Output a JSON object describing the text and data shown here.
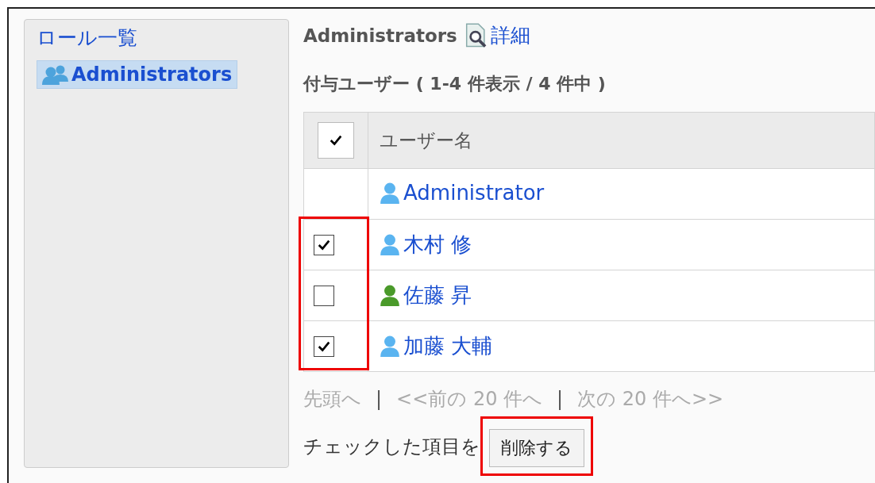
{
  "sidebar": {
    "title": "ロール一覧",
    "items": [
      {
        "label": "Administrators",
        "selected": true
      }
    ]
  },
  "role_title": "Administrators",
  "detail_link": "詳細",
  "section_title": "付与ユーザー ( 1-4 件表示 / 4 件中 )",
  "table": {
    "header_checkbox": {
      "checked": true
    },
    "columns": [
      "ユーザー名"
    ],
    "rows": [
      {
        "name": "Administrator",
        "has_checkbox": false,
        "color": "#5ab4f0",
        "highlighted": false
      },
      {
        "name": "木村 修",
        "has_checkbox": true,
        "checked": true,
        "color": "#5ab4f0",
        "highlighted": true
      },
      {
        "name": "佐藤 昇",
        "has_checkbox": true,
        "checked": false,
        "color": "#4a9a2a",
        "highlighted": true
      },
      {
        "name": "加藤 大輔",
        "has_checkbox": true,
        "checked": true,
        "color": "#5ab4f0",
        "highlighted": true
      }
    ]
  },
  "pagination": [
    {
      "kind": "link",
      "label": "先頭へ",
      "disabled": true
    },
    {
      "kind": "separator",
      "label": "|"
    },
    {
      "kind": "link",
      "label": "<<前の 20 件へ",
      "disabled": true
    },
    {
      "kind": "separator",
      "label": "|"
    },
    {
      "kind": "link",
      "label": "次の 20 件へ>>",
      "disabled": true
    }
  ],
  "action_label": "チェックした項目を",
  "delete_button": {
    "label": "削除する",
    "highlighted": true
  }
}
